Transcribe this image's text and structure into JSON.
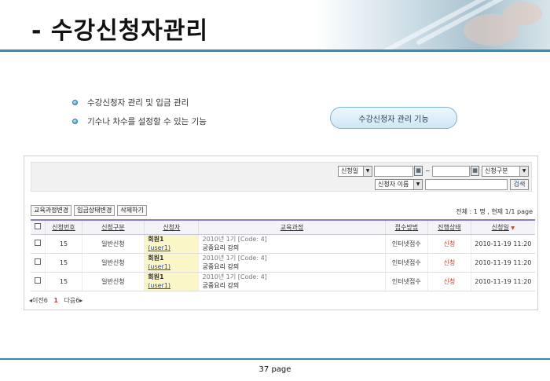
{
  "slide": {
    "title": "- 수강신청자관리",
    "bullets": [
      "수강신청자 관리 및 입금 관리",
      "기수나 차수를 설정할 수 있는 기능"
    ],
    "feature_pill": "수강신청자 관리 기능",
    "page_label": "37 page"
  },
  "search": {
    "date_type": "신청일",
    "tilde": "~",
    "category": "신청구분",
    "name_field": "신청자 이름",
    "name_value": "",
    "search_button": "검색"
  },
  "actions": {
    "change_course": "교육과정변경",
    "change_payment": "입금상태변경",
    "delete": "삭제하기"
  },
  "summary": "전체 : 1 명 ,  현재 1/1 page",
  "table": {
    "columns": [
      "신청번호",
      "신청구분",
      "신청자",
      "교육과정",
      "접수방법",
      "진행상태",
      "신청일"
    ],
    "rows": [
      {
        "no": "15",
        "type": "일반신청",
        "name": "회원1",
        "uid": "(user1)",
        "meta": "2010년 1기 [Code: 4]",
        "course": "궁중요리 강의",
        "method": "인터넷접수",
        "status": "신청",
        "date": "2010-11-19 11:20"
      },
      {
        "no": "15",
        "type": "일반신청",
        "name": "회원1",
        "uid": "(user1)",
        "meta": "2010년 1기 [Code: 4]",
        "course": "궁중요리 강의",
        "method": "인터넷접수",
        "status": "신청",
        "date": "2010-11-19 11:20"
      },
      {
        "no": "15",
        "type": "일반신청",
        "name": "회원1",
        "uid": "(user1)",
        "meta": "2010년 1기 [Code: 4]",
        "course": "궁중요리 강의",
        "method": "인터넷접수",
        "status": "신청",
        "date": "2010-11-19 11:20"
      }
    ]
  },
  "pager": {
    "prev": "◂이전6",
    "current": "1",
    "next": "다음6▸"
  }
}
